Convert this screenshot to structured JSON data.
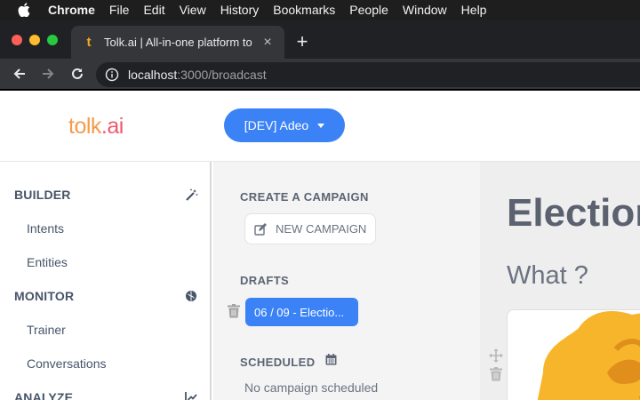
{
  "menubar": {
    "apple": "apple-icon",
    "items": [
      "Chrome",
      "File",
      "Edit",
      "View",
      "History",
      "Bookmarks",
      "People",
      "Window",
      "Help"
    ]
  },
  "browser": {
    "tab": {
      "favicon": "t",
      "title": "Tolk.ai | All-in-one platform to",
      "close": "×"
    },
    "new_tab": "+",
    "url_host": "localhost",
    "url_rest": ":3000/broadcast"
  },
  "header": {
    "logo_part1": "tolk",
    "logo_part2": ".ai",
    "env_label": "[DEV] Adeo"
  },
  "nav": {
    "builder": "BUILDER",
    "intents": "Intents",
    "entities": "Entities",
    "monitor": "MONITOR",
    "trainer": "Trainer",
    "conversations": "Conversations",
    "analyze": "ANALYZE"
  },
  "campaigns": {
    "create_heading": "CREATE A CAMPAIGN",
    "new_campaign": "NEW CAMPAIGN",
    "drafts_heading": "DRAFTS",
    "draft_item": "06 / 09 - Electio...",
    "scheduled_heading": "SCHEDULED",
    "no_scheduled": "No campaign scheduled"
  },
  "editor": {
    "title": "Election",
    "what": "What ?"
  },
  "colors": {
    "accent": "#3b82f6",
    "logo_orange": "#f39c4a",
    "logo_pink": "#ef5a6f",
    "menubar": "#1e1e1e",
    "illustration_yellow": "#f7b52b"
  }
}
